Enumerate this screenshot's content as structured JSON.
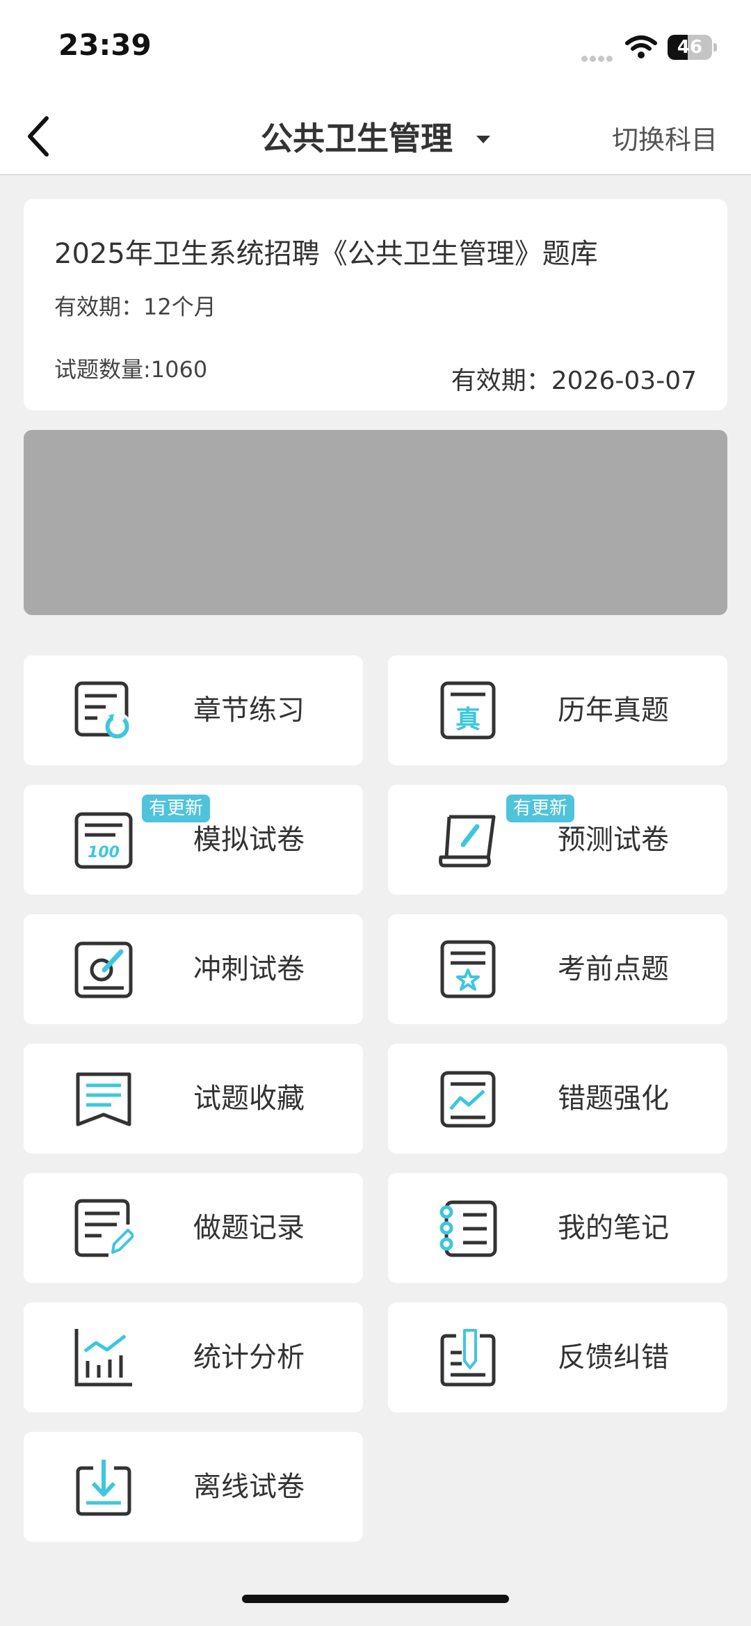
{
  "status": {
    "time": "23:39",
    "battery": "46",
    "battery_level": 0.46
  },
  "nav": {
    "title": "公共卫生管理",
    "switch_label": "切换科目"
  },
  "bank": {
    "title": "2025年卫生系统招聘《公共卫生管理》题库",
    "validity": "有效期：12个月",
    "count": "试题数量:1060",
    "expiry": "有效期：2026-03-07"
  },
  "colors": {
    "accent": "#3ec6de",
    "icon_stroke": "#333333",
    "badge": "#4fc3dc"
  },
  "menu": [
    {
      "label": "章节练习",
      "icon": "chapter-practice-icon"
    },
    {
      "label": "历年真题",
      "icon": "past-exams-icon"
    },
    {
      "label": "模拟试卷",
      "icon": "mock-paper-icon",
      "badge": "有更新"
    },
    {
      "label": "预测试卷",
      "icon": "forecast-paper-icon",
      "badge": "有更新"
    },
    {
      "label": "冲刺试卷",
      "icon": "sprint-paper-icon"
    },
    {
      "label": "考前点题",
      "icon": "pre-exam-tips-icon"
    },
    {
      "label": "试题收藏",
      "icon": "favorites-icon"
    },
    {
      "label": "错题强化",
      "icon": "wrong-questions-icon"
    },
    {
      "label": "做题记录",
      "icon": "practice-record-icon"
    },
    {
      "label": "我的笔记",
      "icon": "notes-icon"
    },
    {
      "label": "统计分析",
      "icon": "statistics-icon"
    },
    {
      "label": "反馈纠错",
      "icon": "feedback-icon"
    },
    {
      "label": "离线试卷",
      "icon": "offline-paper-icon"
    }
  ]
}
